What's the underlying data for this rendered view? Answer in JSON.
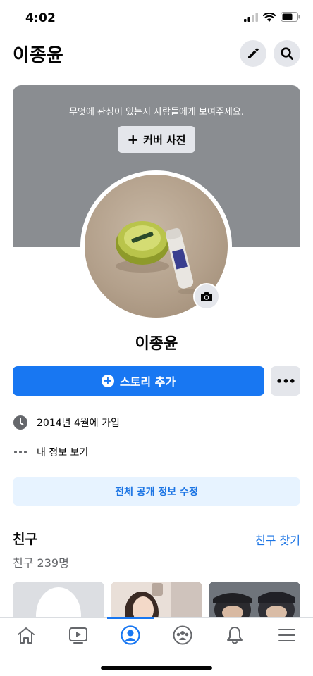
{
  "status_bar": {
    "time": "4:02"
  },
  "header": {
    "title": "이종윤"
  },
  "cover": {
    "prompt": "무엇에 관심이 있는지 사람들에게 보여주세요.",
    "button_icon": "+",
    "button_label": "커버 사진"
  },
  "profile": {
    "name": "이종윤"
  },
  "actions": {
    "story_icon": "+",
    "story_label": "스토리 추가",
    "more_label": "•••"
  },
  "details": {
    "joined": "2014년 4월에 가입",
    "about": "내 정보 보기"
  },
  "edit_public_info": "전체 공개 정보 수정",
  "friends": {
    "title": "친구",
    "find": "친구 찾기",
    "count": "친구 239명"
  },
  "tabs": [
    "home-icon",
    "video-icon",
    "profile-icon",
    "groups-icon",
    "bell-icon",
    "menu-icon"
  ],
  "colors": {
    "accent": "#1877f2",
    "link": "#1b74e4",
    "cover": "#8a8d91",
    "button_gray": "#e4e6eb"
  }
}
